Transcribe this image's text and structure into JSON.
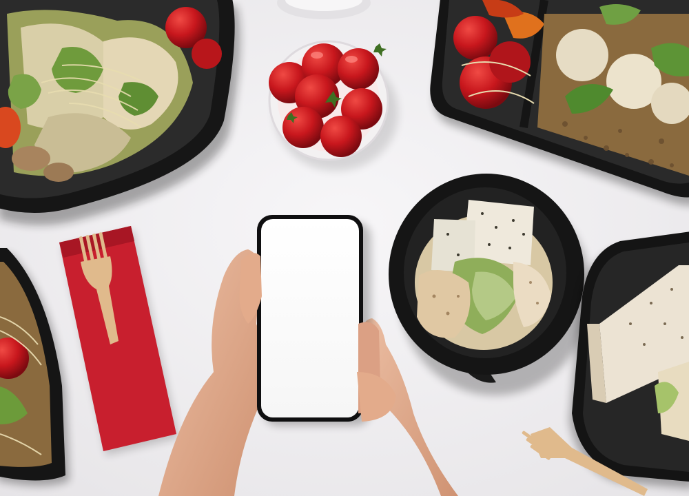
{
  "scene": {
    "kind": "photo",
    "subject": "",
    "colors": {
      "table": "#f1f0f2",
      "container": "#161616",
      "tomato": "#c8171d",
      "napkin": "#c81f2e",
      "wood": "#e0ba8c",
      "skin": "#e3ab8b",
      "screen": "#ffffff",
      "greens": "#7d9b45",
      "bread": "#e9dfcd"
    }
  },
  "phone": {
    "screen_text": ""
  }
}
